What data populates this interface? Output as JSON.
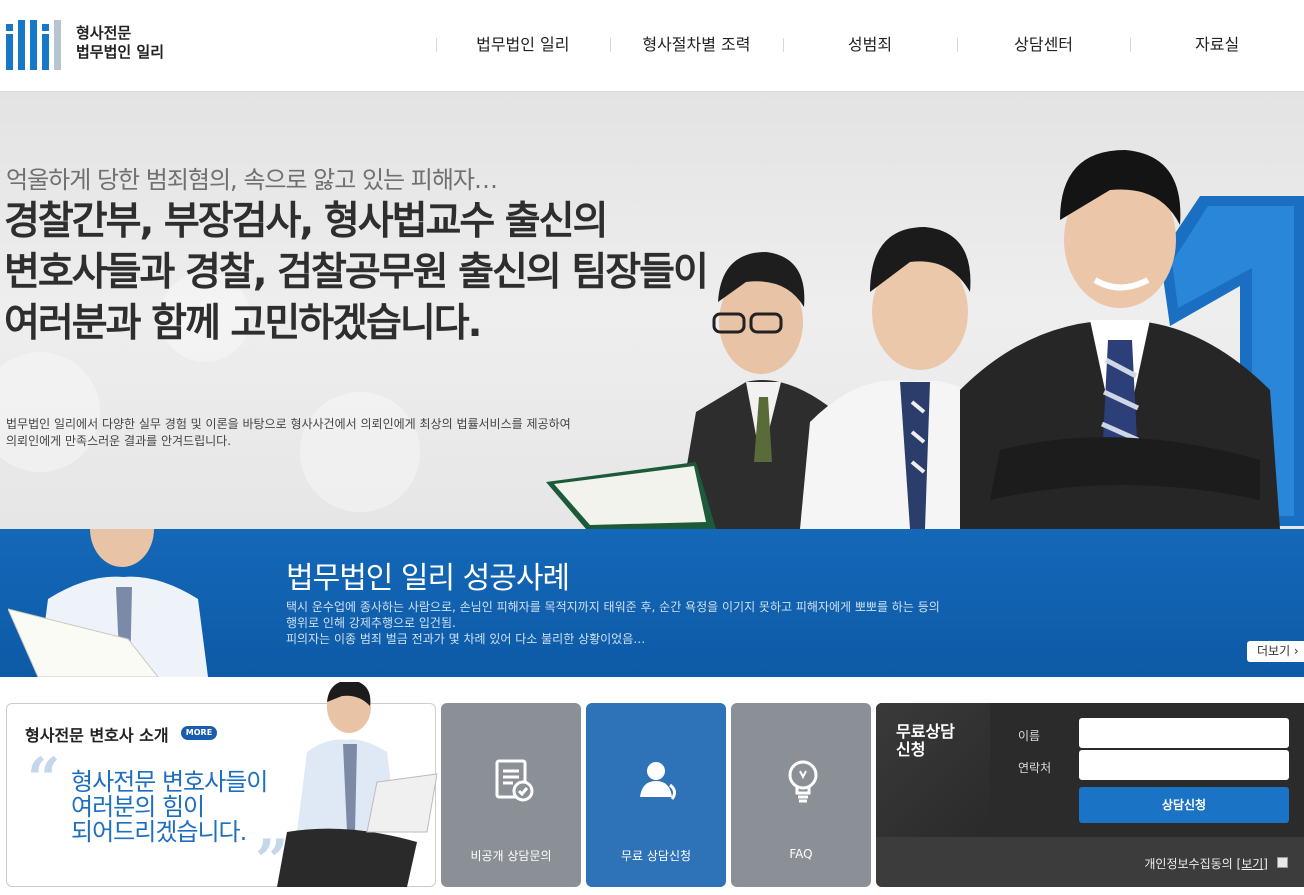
{
  "logo": {
    "line1": "형사전문",
    "line2": "법무법인 일리"
  },
  "nav": [
    "법무법인 일리",
    "형사절차별 조력",
    "성범죄",
    "상담센터",
    "자료실"
  ],
  "hero": {
    "subtitle": "억울하게 당한 범죄혐의, 속으로 앓고 있는 피해자…",
    "title_lines": [
      "경찰간부, 부장검사, 형사법교수 출신의",
      "변호사들과 경찰, 검찰공무원 출신의 팀장들이",
      "여러분과 함께 고민하겠습니다."
    ],
    "desc_lines": [
      "법무법인 일리에서 다양한 실무 경험 및 이론을 바탕으로 형사사건에서 의뢰인에게 최상의 법률서비스를 제공하여",
      "의뢰인에게 만족스러운 결과를 안겨드립니다."
    ]
  },
  "success": {
    "title": "법무법인 일리 성공사례",
    "desc_lines": [
      "택시 운수업에 종사하는 사람으로, 손님인 피해자를 목적지까지 태워준 후, 순간 욕정을 이기지 못하고 피해자에게 뽀뽀를 하는 등의",
      "행위로 인해 강제추행으로 입건됨.",
      "피의자는 이종 범죄 벌금 전과가 몇 차례 있어 다소 불리한 상황이었음…"
    ],
    "more_label": "더보기 ›"
  },
  "intro": {
    "title": "형사전문 변호사 소개",
    "more_badge": "MORE",
    "quote_lines": [
      "형사전문 변호사들이",
      "여러분의 힘이",
      "되어드리겠습니다."
    ]
  },
  "tiles": [
    {
      "label": "비공개 상담문의",
      "icon": "document-check-icon",
      "color": "#888f96"
    },
    {
      "label": "무료 상담신청",
      "icon": "phone-person-icon",
      "color": "#2e72b8"
    },
    {
      "label": "FAQ",
      "icon": "lightbulb-icon",
      "color": "#888f96"
    }
  ],
  "consult": {
    "title_line1": "무료상담",
    "title_line2": "신청",
    "name_label": "이름",
    "phone_label": "연락처",
    "submit_label": "상담신청",
    "privacy_text": "개인정보수집동의",
    "privacy_link": "[보기]"
  }
}
